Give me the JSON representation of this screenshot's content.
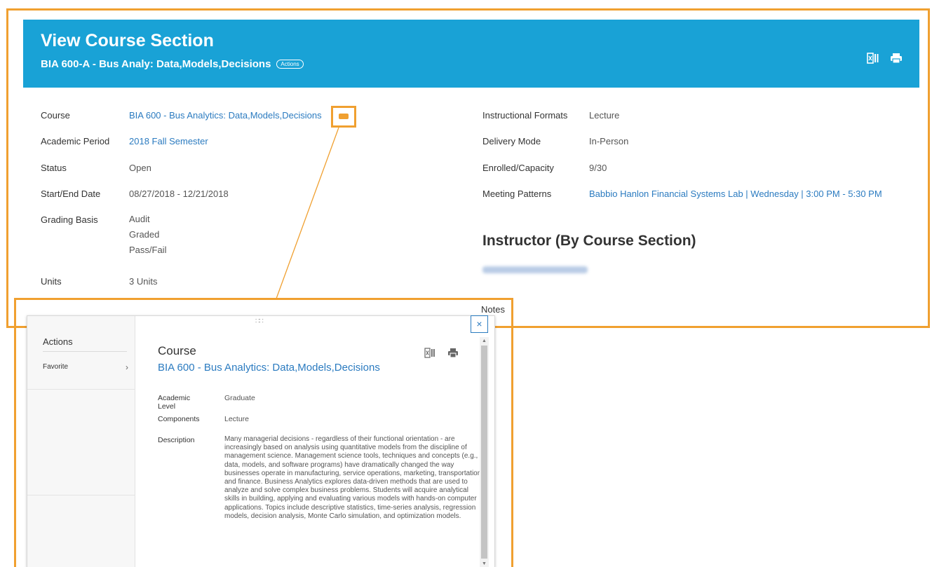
{
  "header": {
    "title": "View Course Section",
    "subtitle": "BIA 600-A - Bus Analy: Data,Models,Decisions",
    "actions_label": "Actions",
    "icons": [
      "export-to-excel-icon",
      "print-icon"
    ]
  },
  "left_fields": [
    {
      "label": "Course",
      "value": "BIA 600 - Bus Analytics: Data,Models,Decisions"
    },
    {
      "label": "Academic Period",
      "value": "2018 Fall Semester"
    },
    {
      "label": "Status",
      "value": "Open"
    },
    {
      "label": "Start/End Date",
      "value": "08/27/2018 - 12/21/2018"
    },
    {
      "label": "Grading Basis",
      "values": [
        "Audit",
        "Graded",
        "Pass/Fail"
      ]
    },
    {
      "label": "Units",
      "value": "3 Units"
    }
  ],
  "right_fields": [
    {
      "label": "Instructional Formats",
      "value": "Lecture"
    },
    {
      "label": "Delivery Mode",
      "value": "In-Person"
    },
    {
      "label": "Enrolled/Capacity",
      "value": "9/30"
    },
    {
      "label": "Meeting Patterns",
      "value": "Babbio Hanlon Financial Systems Lab | Wednesday | 3:00 PM - 5:30 PM"
    }
  ],
  "instructor_heading": "Instructor (By Course Section)",
  "notes_label": "Notes",
  "popup": {
    "sidebar_title": "Actions",
    "sidebar_items": [
      {
        "label": "Favorite"
      }
    ],
    "title": "Course",
    "subtitle": "BIA 600 - Bus Analytics: Data,Models,Decisions",
    "fields": [
      {
        "label": "Academic Level",
        "value": "Graduate"
      },
      {
        "label": "Components",
        "value": "Lecture"
      },
      {
        "label": "Description",
        "value": "Many managerial decisions - regardless of their functional orientation - are increasingly based on analysis using quantitative models from the discipline of management science.  Management science tools, techniques and concepts (e.g., data, models, and software programs) have dramatically changed the way businesses operate in manufacturing, service operations, marketing, transportation, and finance.  Business Analytics explores data-driven methods that are used to analyze and solve complex business problems.  Students will acquire analytical skills in building, applying and evaluating various models with hands-on computer applications.  Topics include descriptive statistics, time-series analysis, regression models, decision analysis, Monte Carlo simulation, and optimization models."
      }
    ],
    "close_glyph": "×"
  },
  "colors": {
    "header_bg": "#19a2d6",
    "link": "#2b7bc0",
    "highlight": "#f0a030"
  }
}
